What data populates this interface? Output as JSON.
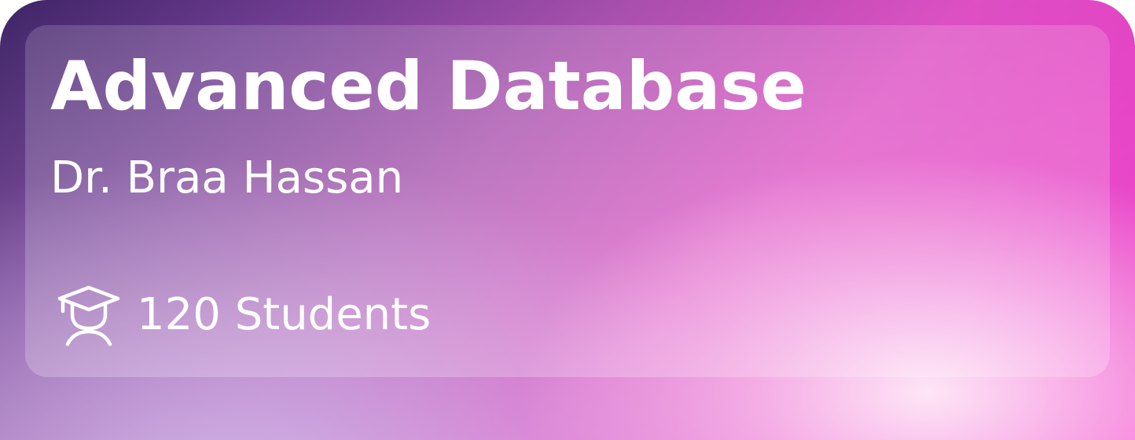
{
  "course": {
    "title": "Advanced Database",
    "instructor": "Dr. Braa Hassan",
    "students_label": "120 Students",
    "students_icon": "graduation-cap-student-icon"
  },
  "colors": {
    "gradient_start": "#3e2466",
    "gradient_mid": "#a84fad",
    "gradient_end": "#f02bc6",
    "text": "#ffffff"
  }
}
